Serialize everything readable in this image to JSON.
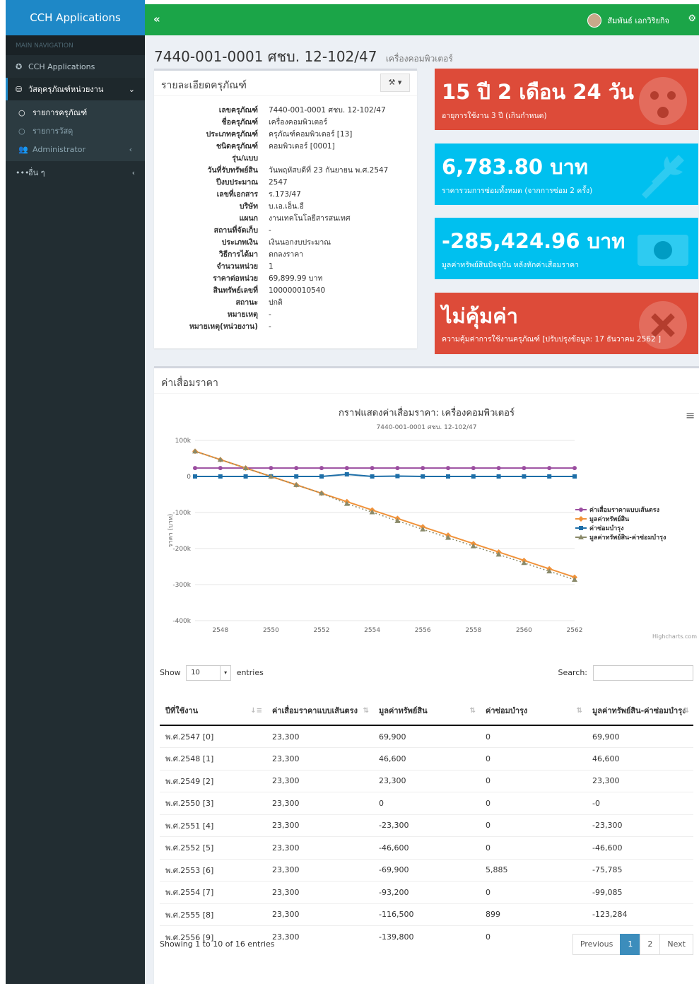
{
  "app_name": "CCH Applications",
  "sidebar": {
    "header": "MAIN NAVIGATION",
    "items": [
      {
        "label": "CCH Applications"
      },
      {
        "label": "วัสดุครุภัณฑ์หน่วยงาน"
      },
      {
        "label": "Administrator"
      },
      {
        "label": "อื่น ๆ"
      }
    ],
    "sub_items": [
      {
        "label": "รายการครุภัณฑ์"
      },
      {
        "label": "รายการวัสดุ"
      }
    ]
  },
  "header": {
    "toggle": "«",
    "user_name": "สัมพันธ์ เอกวิริยกิจ"
  },
  "page": {
    "title": "7440-001-0001 ศชบ. 12-102/47",
    "subtitle": "เครื่องคอมพิวเตอร์"
  },
  "details_box": {
    "title": "รายละเอียดครุภัณฑ์",
    "tool_button": "⚒ ▾",
    "rows": [
      {
        "label": "เลขครุภัณฑ์",
        "value": "7440-001-0001 ศชบ. 12-102/47"
      },
      {
        "label": "ชื่อครุภัณฑ์",
        "value": "เครื่องคอมพิวเตอร์"
      },
      {
        "label": "ประเภทครุภัณฑ์",
        "value": "ครุภัณฑ์คอมพิวเตอร์ [13]"
      },
      {
        "label": "ชนิดครุภัณฑ์",
        "value": "คอมพิวเตอร์ [0001]"
      },
      {
        "label": "รุ่น/แบบ",
        "value": ""
      },
      {
        "label": "วันที่รับทรัพย์สิน",
        "value": "วันพฤหัสบดีที่ 23 กันยายน พ.ศ.2547"
      },
      {
        "label": "ปีงบประมาณ",
        "value": "2547"
      },
      {
        "label": "เลขที่เอกสาร",
        "value": "ร.173/47"
      },
      {
        "label": "บริษัท",
        "value": "บ.เอ.เอ็น.อี"
      },
      {
        "label": "แผนก",
        "value": "งานเทคโนโลยีสารสนเทศ"
      },
      {
        "label": "สถานที่จัดเก็บ",
        "value": "-"
      },
      {
        "label": "ประเภทเงิน",
        "value": "เงินนอกงบประมาณ"
      },
      {
        "label": "วิธีการได้มา",
        "value": "ตกลงราคา"
      },
      {
        "label": "จำนวนหน่วย",
        "value": "1"
      },
      {
        "label": "ราคาต่อหน่วย",
        "value": "69,899.99 บาท"
      },
      {
        "label": "สินทรัพย์เลขที่",
        "value": "100000010540"
      },
      {
        "label": "สถานะ",
        "value": "ปกติ"
      },
      {
        "label": "หมายเหตุ",
        "value": "-"
      },
      {
        "label": "หมายเหตุ(หน่วยงาน)",
        "value": "-"
      }
    ]
  },
  "stats": [
    {
      "big": "15 ปี 2 เดือน 24 วัน",
      "desc": "อายุการใช้งาน 3 ปี (เกินกำหนด)",
      "color": "#dd4b39",
      "icon": "sad-face-icon"
    },
    {
      "big": "6,783.80 บาท",
      "desc": "ราคารวมการซ่อมทั้งหมด (จากการซ่อม 2 ครั้ง)",
      "color": "#00c0ef",
      "icon": "wrench-icon"
    },
    {
      "big": "-285,424.96 บาท",
      "desc": "มูลค่าทรัพย์สินปัจจุบัน หลังหักค่าเสื่อมราคา",
      "color": "#00c0ef",
      "icon": "money-icon"
    },
    {
      "big": "ไม่คุ้มค่า",
      "desc": "ความคุ้มค่าการใช้งานครุภัณฑ์ [ปรับปรุงข้อมูล: 17 ธันวาคม 2562 ]",
      "color": "#dd4b39",
      "icon": "close-circle-icon"
    }
  ],
  "depreciation_box": {
    "title": "ค่าเสื่อมราคา",
    "menu_icon": "≡",
    "credit": "Highcharts.com"
  },
  "chart_data": {
    "type": "line",
    "title": "กราฟแสดงค่าเสื่อมราคา: เครื่องคอมพิวเตอร์",
    "subtitle": "7440-001-0001 ศชบ. 12-102/47",
    "ylabel": "ราคา (บาท)",
    "xlabel": "",
    "ylim": [
      -400000,
      100000
    ],
    "yticks": [
      100000,
      0,
      -100000,
      -200000,
      -300000,
      -400000
    ],
    "ytick_labels": [
      "100k",
      "0",
      "-100k",
      "-200k",
      "-300k",
      "-400k"
    ],
    "xticks": [
      2548,
      2550,
      2552,
      2554,
      2556,
      2558,
      2560,
      2562
    ],
    "x": [
      2547,
      2548,
      2549,
      2550,
      2551,
      2552,
      2553,
      2554,
      2555,
      2556,
      2557,
      2558,
      2559,
      2560,
      2561,
      2562
    ],
    "legend_position": "right",
    "grid": true,
    "series": [
      {
        "name": "ค่าเสื่อมราคาแบบเส้นตรง",
        "color": "#9b4ea0",
        "marker": "circle",
        "values": [
          23300,
          23300,
          23300,
          23300,
          23300,
          23300,
          23300,
          23300,
          23300,
          23300,
          23300,
          23300,
          23300,
          23300,
          23300,
          23300
        ]
      },
      {
        "name": "มูลค่าทรัพย์สิน",
        "color": "#f0923a",
        "marker": "diamond",
        "values": [
          69900,
          46600,
          23300,
          0,
          -23300,
          -46600,
          -69900,
          -93200,
          -116500,
          -139800,
          -163100,
          -186400,
          -209700,
          -233000,
          -256300,
          -279600
        ]
      },
      {
        "name": "ค่าซ่อมบำรุง",
        "color": "#1e6fa8",
        "marker": "square",
        "values": [
          0,
          0,
          0,
          0,
          0,
          0,
          5885,
          0,
          899,
          0,
          0,
          0,
          0,
          0,
          0,
          0
        ]
      },
      {
        "name": "มูลค่าทรัพย์สิน-ค่าซ่อมบำรุง",
        "color": "#8a8a6a",
        "marker": "triangle",
        "dashed": true,
        "values": [
          69900,
          46600,
          23300,
          0,
          -23300,
          -46600,
          -75785,
          -99085,
          -123284,
          -146584,
          -169884,
          -193184,
          -216484,
          -239784,
          -263084,
          -286384
        ]
      }
    ]
  },
  "table": {
    "show_label": "Show",
    "length_value": "10",
    "entries_label": "entries",
    "search_label": "Search:",
    "columns": [
      "ปีที่ใช้งาน",
      "ค่าเสื่อมราคาแบบเส้นตรง",
      "มูลค่าทรัพย์สิน",
      "ค่าซ่อมบำรุง",
      "มูลค่าทรัพย์สิน-ค่าซ่อมบำรุง"
    ],
    "sort_icons": [
      "↓≡",
      "⇅",
      "⇅",
      "⇅",
      "⇅"
    ],
    "rows": [
      [
        "พ.ศ.2547 [0]",
        "23,300",
        "69,900",
        "0",
        "69,900"
      ],
      [
        "พ.ศ.2548 [1]",
        "23,300",
        "46,600",
        "0",
        "46,600"
      ],
      [
        "พ.ศ.2549 [2]",
        "23,300",
        "23,300",
        "0",
        "23,300"
      ],
      [
        "พ.ศ.2550 [3]",
        "23,300",
        "0",
        "0",
        "-0"
      ],
      [
        "พ.ศ.2551 [4]",
        "23,300",
        "-23,300",
        "0",
        "-23,300"
      ],
      [
        "พ.ศ.2552 [5]",
        "23,300",
        "-46,600",
        "0",
        "-46,600"
      ],
      [
        "พ.ศ.2553 [6]",
        "23,300",
        "-69,900",
        "5,885",
        "-75,785"
      ],
      [
        "พ.ศ.2554 [7]",
        "23,300",
        "-93,200",
        "0",
        "-99,085"
      ],
      [
        "พ.ศ.2555 [8]",
        "23,300",
        "-116,500",
        "899",
        "-123,284"
      ],
      [
        "พ.ศ.2556 [9]",
        "23,300",
        "-139,800",
        "0",
        "-146,584"
      ]
    ],
    "info": "Showing 1 to 10 of 16 entries",
    "pagination": {
      "previous": "Previous",
      "pages": [
        "1",
        "2"
      ],
      "current": "1",
      "next": "Next"
    }
  }
}
